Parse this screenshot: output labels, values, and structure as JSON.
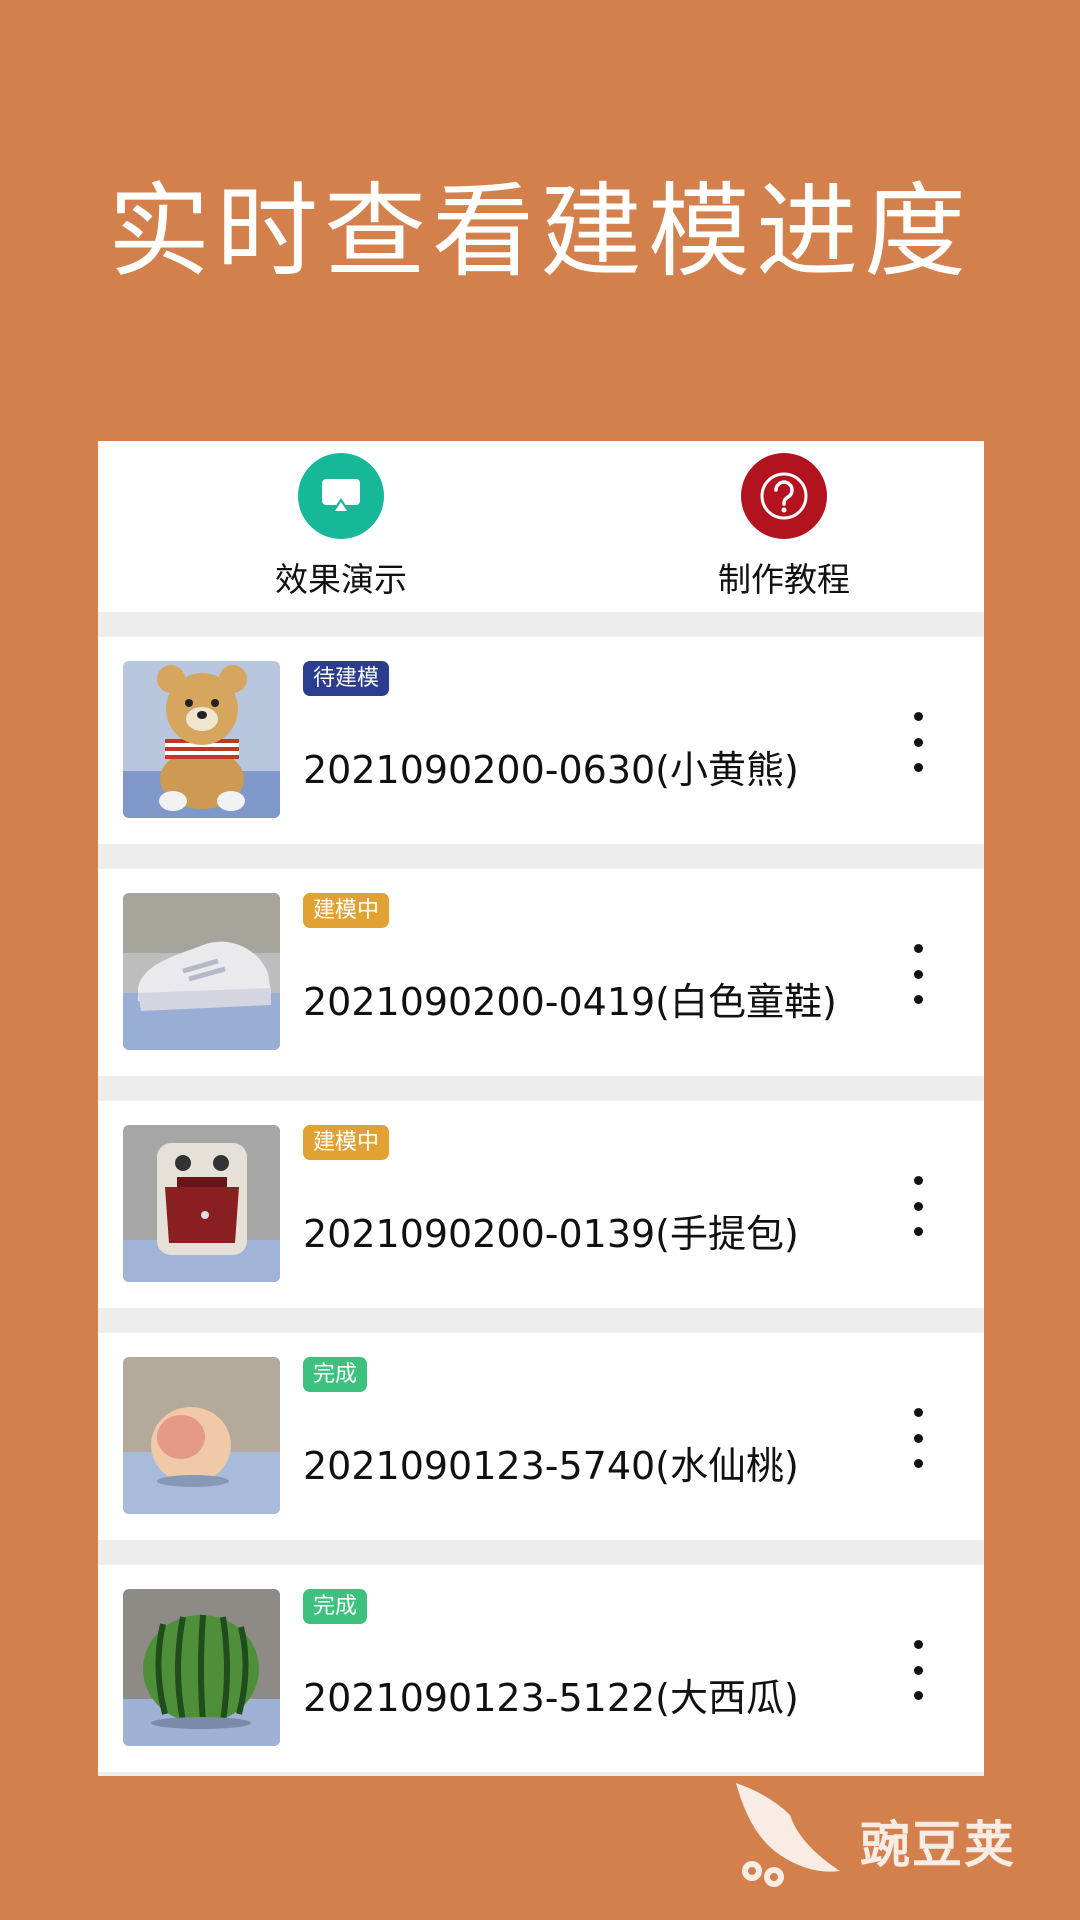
{
  "headline": "实时查看建模进度",
  "shortcuts": [
    {
      "label": "效果演示",
      "icon": "screen-cast-icon",
      "color": "#17b899"
    },
    {
      "label": "制作教程",
      "icon": "question-icon",
      "color": "#b3121f"
    }
  ],
  "items": [
    {
      "status": "待建模",
      "status_color": "#2a3d8f",
      "title": "2021090200-0630(小黄熊)",
      "thumb": "teddy-bear"
    },
    {
      "status": "建模中",
      "status_color": "#e2a233",
      "title": "2021090200-0419(白色童鞋)",
      "thumb": "white-shoe"
    },
    {
      "status": "建模中",
      "status_color": "#e2a233",
      "title": "2021090200-0139(手提包)",
      "thumb": "backpack"
    },
    {
      "status": "完成",
      "status_color": "#3cc27e",
      "title": "2021090123-5740(水仙桃)",
      "thumb": "peach"
    },
    {
      "status": "完成",
      "status_color": "#3cc27e",
      "title": "2021090123-5122(大西瓜)",
      "thumb": "watermelon"
    }
  ],
  "watermark": "豌豆荚"
}
